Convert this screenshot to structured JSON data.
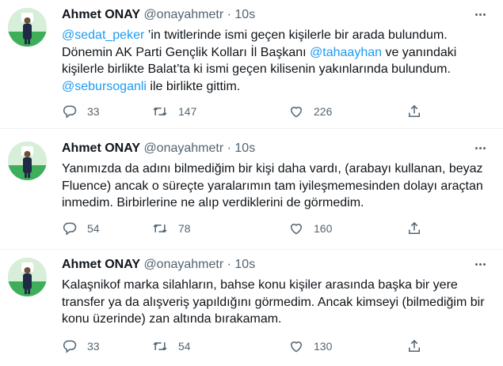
{
  "tweets": [
    {
      "name": "Ahmet ONAY",
      "handle": "@onayahmetr",
      "dot": "·",
      "time": "10s",
      "body": [
        {
          "type": "mention",
          "text": "@sedat_peker"
        },
        {
          "type": "text",
          "text": " ’in twitlerinde ismi geçen kişilerle bir arada bulundum. Dönemin AK Parti Gençlik Kolları İl Başkanı "
        },
        {
          "type": "mention",
          "text": "@tahaayhan"
        },
        {
          "type": "text",
          "text": " ve yanındaki kişilerle birlikte Balat’ta ki ismi geçen kilisenin yakınlarında bulundum. "
        },
        {
          "type": "mention",
          "text": "@sebursoganli"
        },
        {
          "type": "text",
          "text": " ile birlikte gittim."
        }
      ],
      "replies": "33",
      "retweets": "147",
      "likes": "226"
    },
    {
      "name": "Ahmet ONAY",
      "handle": "@onayahmetr",
      "dot": "·",
      "time": "10s",
      "body": [
        {
          "type": "text",
          "text": "Yanımızda da adını bilmediğim bir kişi daha vardı, (arabayı kullanan, beyaz Fluence) ancak o süreçte yaralarımın tam iyileşmemesinden dolayı araçtan inmedim. Birbirlerine ne alıp verdiklerini de görmedim."
        }
      ],
      "replies": "54",
      "retweets": "78",
      "likes": "160"
    },
    {
      "name": "Ahmet ONAY",
      "handle": "@onayahmetr",
      "dot": "·",
      "time": "10s",
      "body": [
        {
          "type": "text",
          "text": "Kalaşnikof marka silahların, bahse konu kişiler arasında başka bir yere transfer ya da alışveriş yapıldığını görmedim. Ancak kimseyi (bilmediğim bir konu üzerinde) zan altında bırakamam."
        }
      ],
      "replies": "33",
      "retweets": "54",
      "likes": "130"
    }
  ],
  "colors": {
    "text": "#0f1419",
    "secondary": "#536471",
    "mention": "#1d9bf0",
    "divider": "#eff3f4"
  },
  "icons": [
    "avatar",
    "more-icon",
    "reply-icon",
    "retweet-icon",
    "like-icon",
    "share-icon"
  ]
}
